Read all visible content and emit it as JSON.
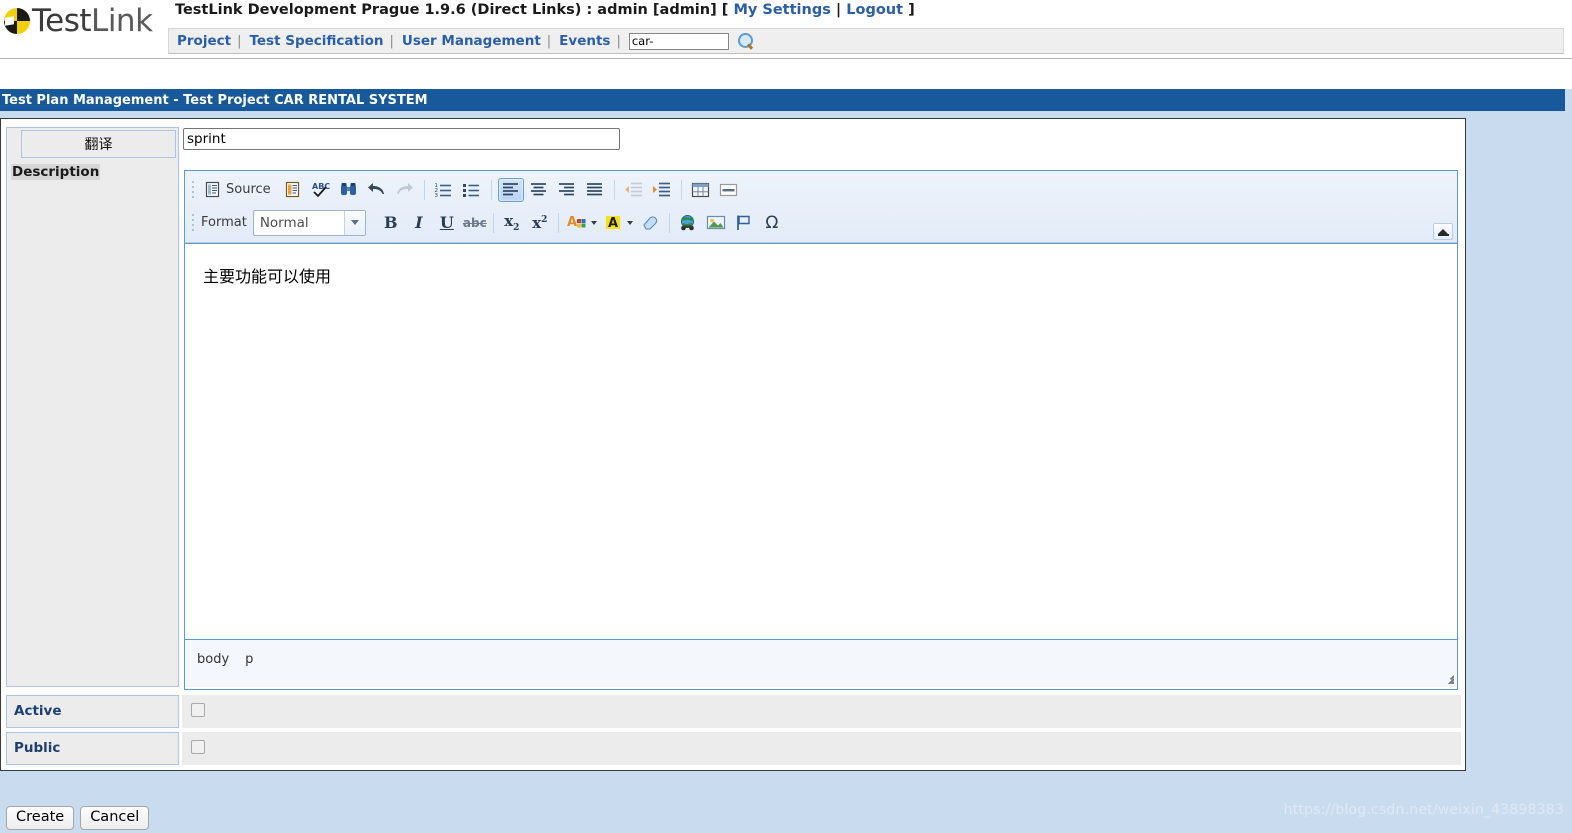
{
  "app": {
    "logo_text_part1": "Test",
    "logo_text_part2": "Link",
    "logo_icon": "testlink-circle-logo"
  },
  "header": {
    "title_prefix": "TestLink Development Prague 1.9.6 (Direct Links) : admin [admin] [ ",
    "my_settings": "My Settings",
    "title_sep": " | ",
    "logout": "Logout",
    "title_suffix": " ]"
  },
  "nav": {
    "items": [
      {
        "label": "Project"
      },
      {
        "label": "Test Specification"
      },
      {
        "label": "User Management"
      },
      {
        "label": "Events"
      }
    ],
    "separator": "|",
    "search_value": "car-",
    "search_placeholder": "",
    "search_icon": "magnifier-icon"
  },
  "page": {
    "title": "Test Plan Management - Test Project CAR RENTAL SYSTEM"
  },
  "form": {
    "translate_tab": "翻译",
    "description_label": "Description",
    "name_value": "sprint",
    "rows": [
      {
        "label": "Active",
        "checked": false
      },
      {
        "label": "Public",
        "checked": false
      }
    ]
  },
  "editor": {
    "toolbar_row1": [
      {
        "name": "source-button",
        "label": "Source",
        "icon": "source-icon"
      },
      {
        "name": "templates-button",
        "label": "",
        "icon": "templates-icon"
      },
      {
        "name": "spellcheck-button",
        "label": "",
        "icon": "spellcheck-abc-icon"
      },
      {
        "name": "find-button",
        "label": "",
        "icon": "binoculars-find-icon"
      },
      {
        "name": "undo-button",
        "label": "",
        "icon": "undo-arrow-icon"
      },
      {
        "name": "redo-button",
        "label": "",
        "icon": "redo-arrow-icon"
      },
      {
        "name": "numbered-list-button",
        "label": "",
        "icon": "numbered-list-icon"
      },
      {
        "name": "bulleted-list-button",
        "label": "",
        "icon": "bulleted-list-icon"
      },
      {
        "name": "align-left-button",
        "label": "",
        "icon": "align-left-icon"
      },
      {
        "name": "align-center-button",
        "label": "",
        "icon": "align-center-icon"
      },
      {
        "name": "align-right-button",
        "label": "",
        "icon": "align-right-icon"
      },
      {
        "name": "justify-button",
        "label": "",
        "icon": "justify-icon"
      },
      {
        "name": "outdent-button",
        "label": "",
        "icon": "decrease-indent-icon"
      },
      {
        "name": "indent-button",
        "label": "",
        "icon": "increase-indent-icon"
      },
      {
        "name": "table-button",
        "label": "",
        "icon": "table-icon"
      },
      {
        "name": "horizontal-rule-button",
        "label": "",
        "icon": "horizontal-rule-icon"
      }
    ],
    "format_label": "Format",
    "format_value": "Normal",
    "toolbar_row2": [
      {
        "name": "bold-button",
        "label": "B",
        "icon": "bold-icon"
      },
      {
        "name": "italic-button",
        "label": "I",
        "icon": "italic-icon"
      },
      {
        "name": "underline-button",
        "label": "U",
        "icon": "underline-icon"
      },
      {
        "name": "strikethrough-button",
        "label": "abc",
        "icon": "strikethrough-icon"
      },
      {
        "name": "subscript-button",
        "label": "x",
        "icon": "subscript-icon"
      },
      {
        "name": "superscript-button",
        "label": "x",
        "icon": "superscript-icon"
      },
      {
        "name": "text-color-button",
        "label": "A",
        "icon": "text-color-icon"
      },
      {
        "name": "background-color-button",
        "label": "A",
        "icon": "background-color-icon"
      },
      {
        "name": "remove-format-button",
        "label": "",
        "icon": "eraser-icon"
      },
      {
        "name": "link-button",
        "label": "",
        "icon": "link-globe-icon"
      },
      {
        "name": "image-button",
        "label": "",
        "icon": "image-icon"
      },
      {
        "name": "anchor-button",
        "label": "",
        "icon": "flag-anchor-icon"
      },
      {
        "name": "special-char-button",
        "label": "Ω",
        "icon": "omega-icon"
      }
    ],
    "collapse_icon": "collapse-toolbar-icon",
    "content_text": "主要功能可以使用",
    "elements_path": [
      "body",
      "p"
    ],
    "resize_icon": "resize-grip-icon"
  },
  "footer": {
    "create_label": "Create",
    "cancel_label": "Cancel"
  },
  "watermark": {
    "text": "https://blog.csdn.net/weixin_43898383"
  },
  "colors": {
    "title_bar": "#18599c",
    "link": "#2b5ea8",
    "page_background": "#c9dcef",
    "label_cell": "#ececec",
    "label_border": "#aec4e2",
    "editor_border": "#5b9bd5"
  }
}
